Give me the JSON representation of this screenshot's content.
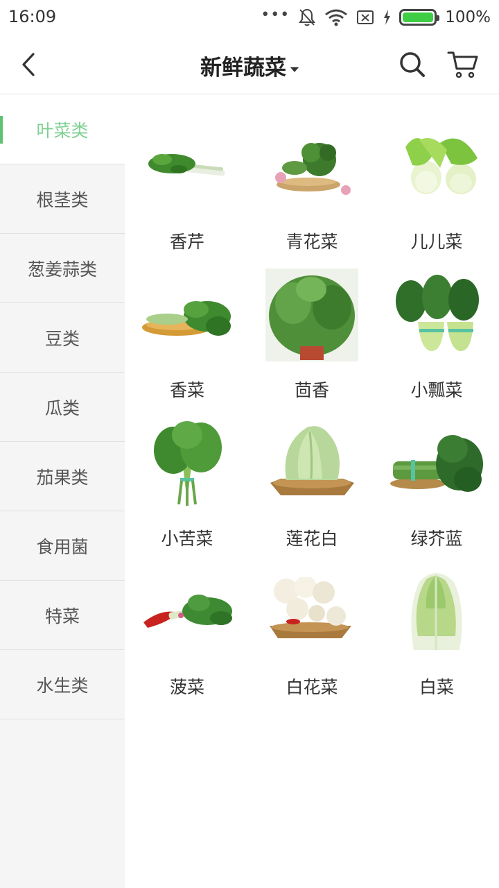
{
  "status_bar": {
    "time": "16:09",
    "dots": "•••",
    "battery": "100%"
  },
  "header": {
    "title": "新鲜蔬菜"
  },
  "colors": {
    "accent": "#5fc272",
    "sidebar_bg": "#f5f5f5"
  },
  "sidebar": {
    "items": [
      {
        "label": "叶菜类"
      },
      {
        "label": "根茎类"
      },
      {
        "label": "葱姜蒜类"
      },
      {
        "label": "豆类"
      },
      {
        "label": "瓜类"
      },
      {
        "label": "茄果类"
      },
      {
        "label": "食用菌"
      },
      {
        "label": "特菜"
      },
      {
        "label": "水生类"
      }
    ],
    "active_index": 0
  },
  "products": [
    {
      "label": "香芹",
      "icon": "celery-image"
    },
    {
      "label": "青花菜",
      "icon": "broccoli-image"
    },
    {
      "label": "儿儿菜",
      "icon": "baby-mustard-image"
    },
    {
      "label": "香菜",
      "icon": "coriander-image"
    },
    {
      "label": "茴香",
      "icon": "fennel-image"
    },
    {
      "label": "小瓢菜",
      "icon": "bok-choy-image"
    },
    {
      "label": "小苦菜",
      "icon": "bitter-greens-image"
    },
    {
      "label": "莲花白",
      "icon": "cabbage-image"
    },
    {
      "label": "绿芥蓝",
      "icon": "chinese-kale-image"
    },
    {
      "label": "菠菜",
      "icon": "spinach-image"
    },
    {
      "label": "白花菜",
      "icon": "cauliflower-image"
    },
    {
      "label": "白菜",
      "icon": "napa-cabbage-image"
    }
  ]
}
